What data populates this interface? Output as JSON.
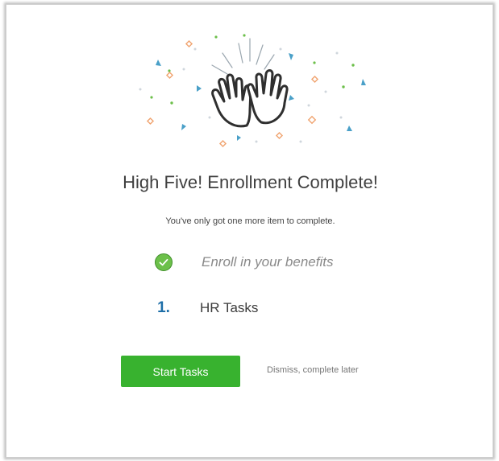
{
  "headline": "High Five! Enrollment Complete!",
  "subtext": "You've only got one more item to complete.",
  "steps": [
    {
      "status": "complete",
      "icon": "check-circle-icon",
      "label": "Enroll in your benefits"
    },
    {
      "status": "pending",
      "number": "1.",
      "label": "HR Tasks"
    }
  ],
  "actions": {
    "start_label": "Start Tasks",
    "dismiss_label": "Dismiss, complete later"
  },
  "illustration": {
    "icon": "high-five-hands-icon",
    "decoration": "confetti"
  },
  "colors": {
    "primary_button": "#38b22f",
    "check": "#6cc04a",
    "step_number": "#1e6fa8",
    "confetti": [
      "#f0a470",
      "#4aa0c8",
      "#6cbf4a"
    ]
  }
}
